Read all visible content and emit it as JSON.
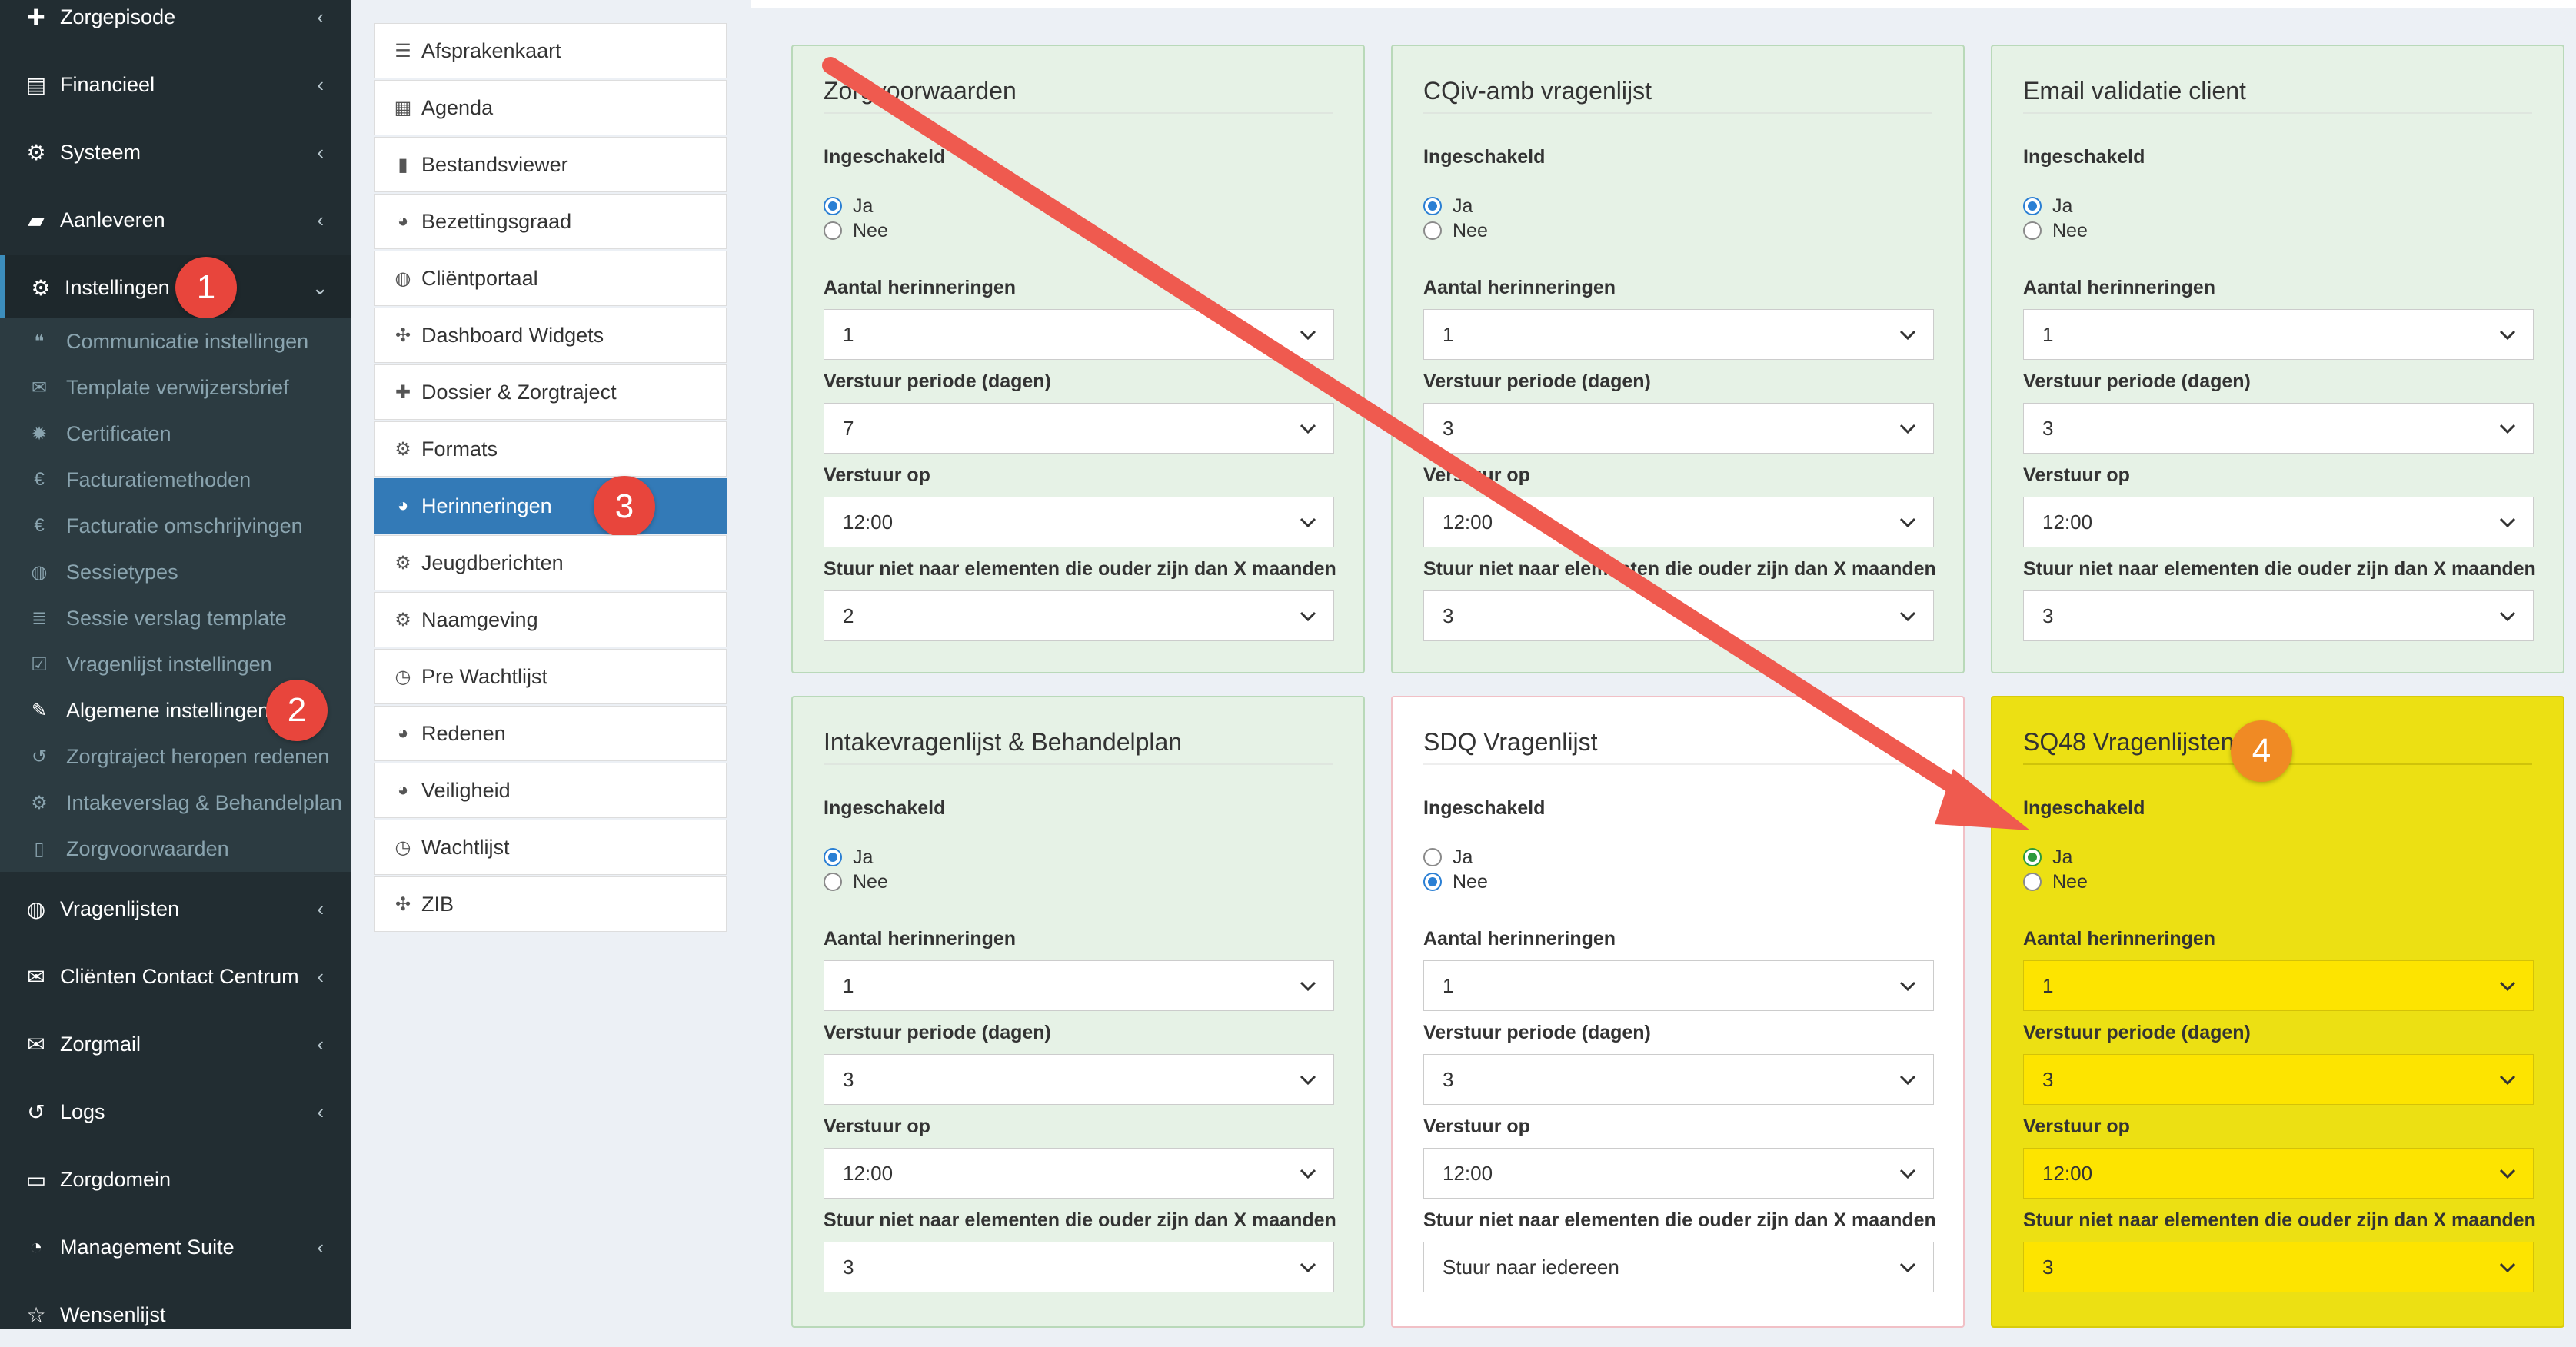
{
  "sidebar": {
    "items": [
      {
        "label": "Zorgepisode",
        "icon": "medkit-icon",
        "chevron": "‹"
      },
      {
        "label": "Financieel",
        "icon": "book-icon",
        "chevron": "‹"
      },
      {
        "label": "Systeem",
        "icon": "cogs-icon",
        "chevron": "‹"
      },
      {
        "label": "Aanleveren",
        "icon": "truck-icon",
        "chevron": "‹"
      },
      {
        "label": "Instellingen",
        "icon": "gear-icon",
        "chevron": "⌄"
      },
      {
        "label": "Vragenlijsten",
        "icon": "globe-icon",
        "chevron": "‹"
      },
      {
        "label": "Cliënten Contact Centrum",
        "icon": "envelope-icon",
        "chevron": "‹"
      },
      {
        "label": "Zorgmail",
        "icon": "envelope-icon",
        "chevron": "‹"
      },
      {
        "label": "Logs",
        "icon": "history-icon",
        "chevron": "‹"
      },
      {
        "label": "Zorgdomein",
        "icon": "inbox-icon",
        "chevron": ""
      },
      {
        "label": "Management Suite",
        "icon": "dashboard-icon",
        "chevron": "‹"
      },
      {
        "label": "Wensenlijst",
        "icon": "star-icon",
        "chevron": ""
      }
    ],
    "submenu": [
      {
        "label": "Communicatie instellingen",
        "icon": "comments-icon"
      },
      {
        "label": "Template verwijzersbrief",
        "icon": "envelope-icon"
      },
      {
        "label": "Certificaten",
        "icon": "certificate-icon"
      },
      {
        "label": "Facturatiemethoden",
        "icon": "euro-icon"
      },
      {
        "label": "Facturatie omschrijvingen",
        "icon": "euro-icon"
      },
      {
        "label": "Sessietypes",
        "icon": "globe-icon"
      },
      {
        "label": "Sessie verslag template",
        "icon": "list-icon"
      },
      {
        "label": "Vragenlijst instellingen",
        "icon": "check-square-icon"
      },
      {
        "label": "Algemene instellingen",
        "icon": "wrench-icon"
      },
      {
        "label": "Zorgtraject heropen redenen",
        "icon": "undo-icon"
      },
      {
        "label": "Intakeverslag & Behandelplan",
        "icon": "gear-icon"
      },
      {
        "label": "Zorgvoorwaarden",
        "icon": "file-pdf-icon"
      }
    ]
  },
  "badges": [
    "1",
    "2",
    "3",
    "4"
  ],
  "settings_list": [
    {
      "label": "Afsprakenkaart",
      "icon": "list-alt-icon"
    },
    {
      "label": "Agenda",
      "icon": "calendar-icon"
    },
    {
      "label": "Bestandsviewer",
      "icon": "file-icon"
    },
    {
      "label": "Bezettingsgraad",
      "icon": "pie-chart-icon"
    },
    {
      "label": "Cliëntportaal",
      "icon": "globe-icon"
    },
    {
      "label": "Dashboard Widgets",
      "icon": "puzzle-icon"
    },
    {
      "label": "Dossier & Zorgtraject",
      "icon": "medkit-icon"
    },
    {
      "label": "Formats",
      "icon": "gear-icon"
    },
    {
      "label": "Herinneringen",
      "icon": "pie-chart-icon"
    },
    {
      "label": "Jeugdberichten",
      "icon": "gear-icon"
    },
    {
      "label": "Naamgeving",
      "icon": "gear-icon"
    },
    {
      "label": "Pre Wachtlijst",
      "icon": "clock-icon"
    },
    {
      "label": "Redenen",
      "icon": "pie-chart-icon"
    },
    {
      "label": "Veiligheid",
      "icon": "pie-chart-icon"
    },
    {
      "label": "Wachtlijst",
      "icon": "clock-icon"
    },
    {
      "label": "ZIB",
      "icon": "puzzle-icon"
    }
  ],
  "field_labels": {
    "enabled": "Ingeschakeld",
    "yes": "Ja",
    "no": "Nee",
    "reminders": "Aantal herinneringen",
    "period": "Verstuur periode (dagen)",
    "send_at": "Verstuur op",
    "max_age": "Stuur niet naar elementen die ouder zijn dan X maanden"
  },
  "panels": [
    {
      "title": "Zorgvoorwaarden",
      "enabled": "Ja",
      "reminders": "1",
      "period": "7",
      "send_at": "12:00",
      "max_age": "2"
    },
    {
      "title": "CQiv-amb vragenlijst",
      "enabled": "Ja",
      "reminders": "1",
      "period": "3",
      "send_at": "12:00",
      "max_age": "3"
    },
    {
      "title": "Email validatie client",
      "enabled": "Ja",
      "reminders": "1",
      "period": "3",
      "send_at": "12:00",
      "max_age": "3"
    },
    {
      "title": "Intakevragenlijst & Behandelplan",
      "enabled": "Ja",
      "reminders": "1",
      "period": "3",
      "send_at": "12:00",
      "max_age": "3"
    },
    {
      "title": "SDQ Vragenlijst",
      "enabled": "Nee",
      "reminders": "1",
      "period": "3",
      "send_at": "12:00",
      "max_age": "Stuur naar iedereen"
    },
    {
      "title": "SQ48 Vragenlijsten",
      "enabled": "Ja",
      "reminders": "1",
      "period": "3",
      "send_at": "12:00",
      "max_age": "3"
    }
  ],
  "colors": {
    "sidebar_bg": "#222d32",
    "accent_blue": "#337ab7",
    "badge_red": "#e8453c",
    "panel_green": "#e6f2e6",
    "highlight_yellow": "#ece013",
    "arrow_red": "#ef5a4f"
  }
}
